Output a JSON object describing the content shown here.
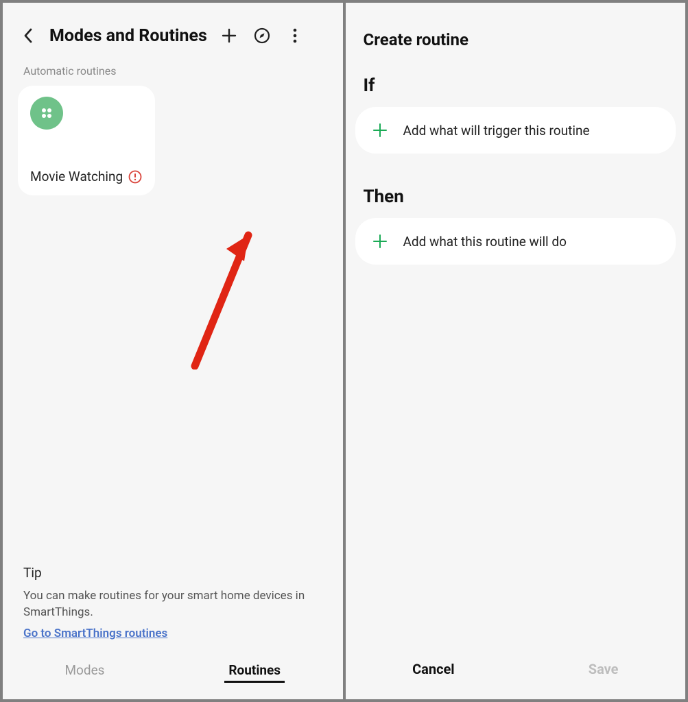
{
  "left": {
    "title": "Modes and Routines",
    "section_label": "Automatic routines",
    "routines": [
      {
        "name": "Movie Watching",
        "warning": true
      }
    ],
    "tip": {
      "heading": "Tip",
      "text": "You can make routines for your smart home devices in SmartThings.",
      "link": "Go to SmartThings routines"
    },
    "tabs": {
      "modes": "Modes",
      "routines": "Routines",
      "active": "routines"
    }
  },
  "right": {
    "title": "Create routine",
    "if_label": "If",
    "if_action": "Add what will trigger this routine",
    "then_label": "Then",
    "then_action": "Add what this routine will do",
    "cancel": "Cancel",
    "save": "Save",
    "save_enabled": false
  },
  "colors": {
    "accent_green": "#1aaa55",
    "routine_icon_bg": "#6fc289",
    "link": "#4a73c9",
    "arrow": "#e02514"
  }
}
